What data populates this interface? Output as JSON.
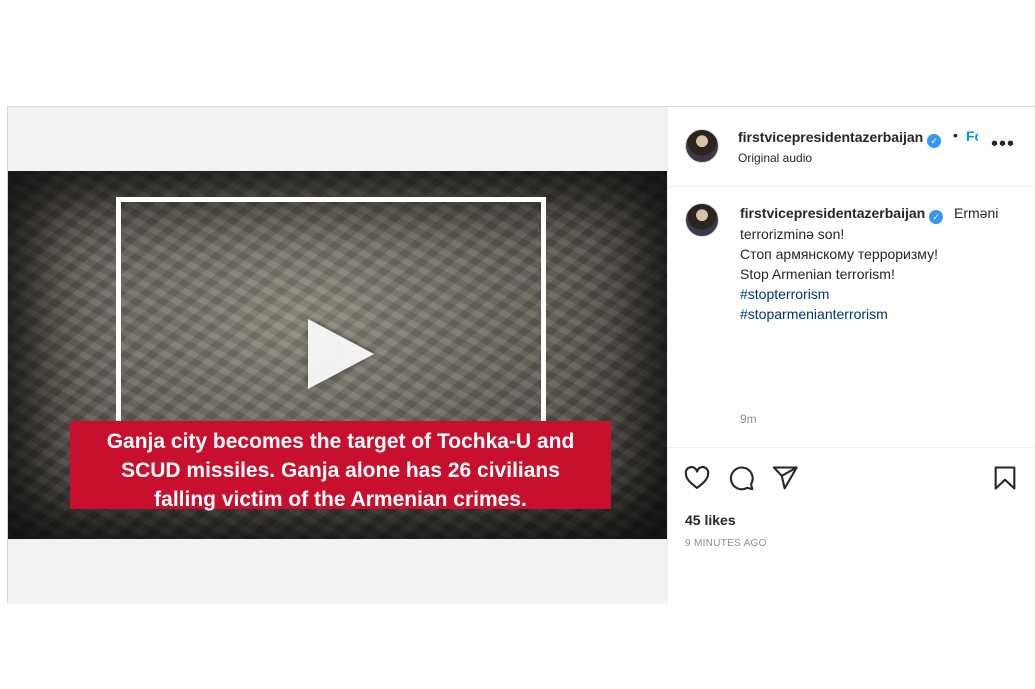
{
  "post": {
    "username": "firstvicepresidentazerbaijan",
    "follow_label": "Follow",
    "audio_label": "Original audio",
    "more_label": "•••",
    "dot_separator": "•"
  },
  "video": {
    "banner_text": "Ganja city becomes the target of Tochka-U and\nSCUD missiles. Ganja alone has 26 civilians\nfalling victim of the  Armenian crimes."
  },
  "caption": {
    "first_line": "Erməni",
    "lines": [
      "terrorizminə son!",
      "Стоп армянскому терроризму!",
      "Stop Armenian terrorism!"
    ],
    "hashtags": [
      "#stopterrorism",
      "#stoparmenianterrorism"
    ],
    "time": "9m"
  },
  "actions": {
    "likes": "45 likes",
    "time_ago": "9 MINUTES AGO"
  },
  "icons": {
    "verified": "verified-badge-icon",
    "like": "heart-icon",
    "comment": "comment-icon",
    "share": "paper-plane-icon",
    "save": "bookmark-icon",
    "play": "play-icon"
  },
  "colors": {
    "banner": "#c8102e",
    "link": "#00376b",
    "follow": "#0095f6",
    "verified": "#3897f0"
  }
}
